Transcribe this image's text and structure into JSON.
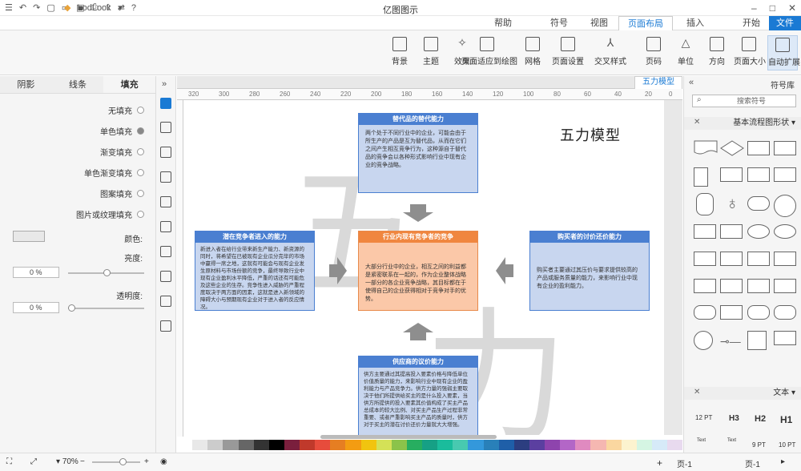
{
  "window": {
    "title": "亿图图示",
    "logo": "LodLook"
  },
  "tabs": [
    {
      "label": "文件"
    },
    {
      "label": "开始"
    },
    {
      "label": "插入"
    },
    {
      "label": "页面布局"
    },
    {
      "label": "视图"
    },
    {
      "label": "符号"
    },
    {
      "label": "帮助"
    }
  ],
  "ribbon": [
    {
      "label": "自动扩展"
    },
    {
      "label": "页面大小"
    },
    {
      "label": "方向"
    },
    {
      "label": "单位"
    },
    {
      "label": "页码"
    },
    {
      "label": "交叉样式"
    },
    {
      "label": "页面设置"
    },
    {
      "label": "网格"
    },
    {
      "label": "页面适应到绘图"
    },
    {
      "label": "效果"
    },
    {
      "label": "主题"
    },
    {
      "label": "背景"
    }
  ],
  "left_panel": {
    "tabs": [
      "填充",
      "线条",
      "阴影"
    ],
    "fill_options": [
      "无填充",
      "单色填充",
      "渐变填充",
      "单色渐变填充",
      "图案填充",
      "图片或纹理填充"
    ],
    "color_label": "颜色:",
    "shade_label": "亮度:",
    "shade_value": "0 %",
    "transparency_label": "透明度:",
    "transparency_value": "0 %"
  },
  "document": {
    "tab": "五力模型",
    "title": "五力模型",
    "ruler": [
      "320",
      "300",
      "280",
      "260",
      "240",
      "220",
      "200",
      "180",
      "160",
      "140",
      "120",
      "100",
      "80",
      "60",
      "40",
      "20",
      "0"
    ]
  },
  "boxes": {
    "top": {
      "title": "替代品的替代能力",
      "body": "两个处于不同行业中的企业，可能会由于所生产的产品是互为替代品，从而在它们之间产生相互竞争行为，这种源自于替代品的竞争会以各种形式影响行业中现有企业的竞争战略。"
    },
    "left": {
      "title": "潜在竞争者进入的能力",
      "body": "新进入者在给行业带来新生产能力、新资源的同时，将希望在已被现有企业瓜分完毕的市场中赢得一席之地，这就有可能会与现有企业发生原材料与市场份额的竞争，最终导致行业中现有企业盈利水平降低，严重的话还有可能危及这些企业的生存。竞争性进入威胁的严重程度取决于两方面的因素，这就是进入新领域的障碍大小与预期现有企业对于进入者的反应情况。"
    },
    "center": {
      "title": "行业内现有竞争者的竞争",
      "body": "大部分行业中的企业，相互之间的利益都是紧密联系在一起的，作为企业整体战略一部分的各企业竞争战略，其目标都在于使得自己的企业获得相对于竞争对手的优势。"
    },
    "right": {
      "title": "购买者的讨价还价能力",
      "body": "购买者主要通过其压价与要求提供较高的产品或服务质量的能力，来影响行业中现有企业的盈利能力。"
    },
    "bottom": {
      "title": "供应商的议价能力",
      "body": "供方主要通过其提高投入要素价格与降低单位价值质量的能力，来影响行业中现有企业的盈利能力与产品竞争力。供方力量的强弱主要取决于他们所提供给买主的是什么投入要素，当供方所提供的投入要素其价值构成了买主产品总成本的较大比例、对买主产品生产过程非常重要、或者严重影响买主产品的质量时，供方对于买主的潜在讨价还价力量就大大增强。"
    }
  },
  "right_panel": {
    "title": "符号库",
    "search_placeholder": "搜索符号",
    "section1": "基本流程图形状",
    "section2": "文本",
    "text_samples": [
      "H1",
      "H2",
      "H3",
      "12 PT",
      "10 PT",
      "9 PT",
      "Text",
      "Text"
    ]
  },
  "status": {
    "page_label": "页-1",
    "page_tab": "页-1",
    "zoom": "70%"
  },
  "colors": {
    "accent": "#1a7ad4",
    "box_blue": "#4a7fd1",
    "box_fill": "#c8d6ef",
    "center_head": "#f0863f",
    "center_fill": "#fbc8a8"
  }
}
